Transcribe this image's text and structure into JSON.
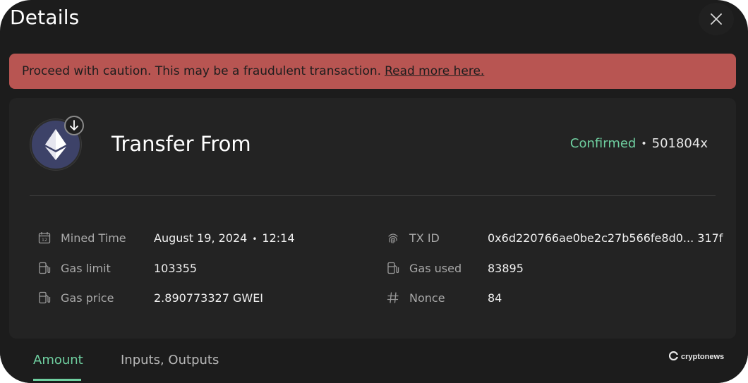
{
  "header": {
    "title": "Details",
    "close_icon": "close-icon"
  },
  "warning": {
    "text": "Proceed with caution. This may be a fraudulent transaction.",
    "link": "Read more here.",
    "color": "#b85552"
  },
  "transaction": {
    "type": "Transfer From",
    "token_icon": "ethereum-icon",
    "direction_icon": "arrow-down-icon",
    "status": "Confirmed",
    "status_color": "#6fcfa0",
    "hash_short": "501804x"
  },
  "details": {
    "mined_time_label": "Mined Time",
    "mined_date": "August 19, 2024",
    "mined_clock": "12:14",
    "gas_limit_label": "Gas limit",
    "gas_limit": "103355",
    "gas_price_label": "Gas price",
    "gas_price": "2.890773327 GWEI",
    "tx_id_label": "TX ID",
    "tx_id": "0x6d220766ae0be2c27b566fe8d0... 317f",
    "gas_used_label": "Gas used",
    "gas_used": "83895",
    "nonce_label": "Nonce",
    "nonce": "84"
  },
  "tabs": [
    {
      "label": "Amount",
      "active": true
    },
    {
      "label": "Inputs, Outputs",
      "active": false
    }
  ],
  "watermark": {
    "text": "cryptonews"
  },
  "colors": {
    "background": "#1c1c1c",
    "card": "#232323",
    "accent": "#6fcfa0"
  }
}
